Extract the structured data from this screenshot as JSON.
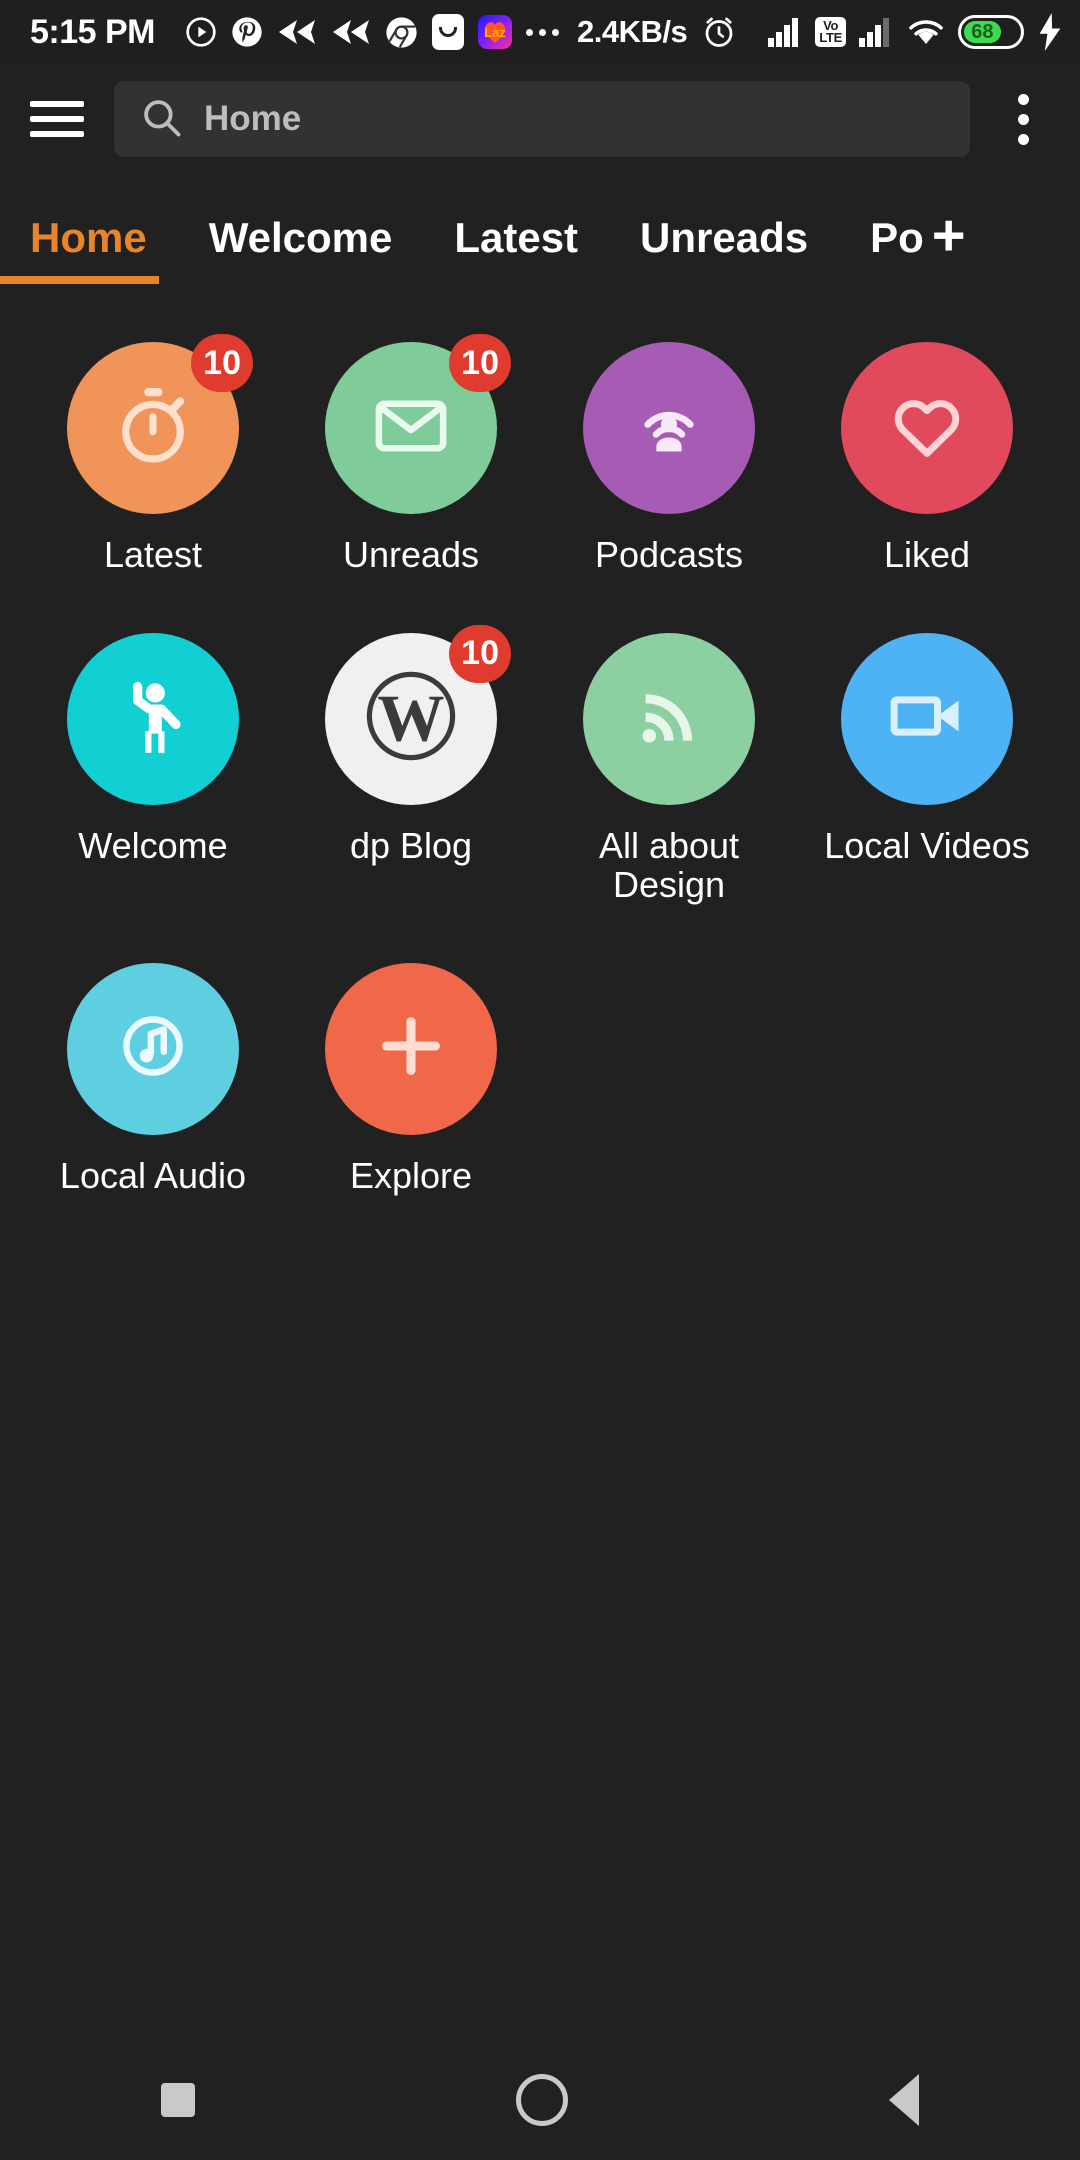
{
  "statusbar": {
    "time": "5:15 PM",
    "network_speed": "2.4KB/s",
    "battery_percent": "68",
    "volte_top": "Vo",
    "volte_bottom": "LTE",
    "laz_label": "Laz",
    "icons": [
      "play-circle-icon",
      "pinterest-icon",
      "arrow-left-double-icon",
      "arrow-left-double-icon",
      "chrome-icon",
      "smile-app-icon",
      "lazada-icon",
      "more-dots-icon",
      "alarm-clock-icon",
      "signal-bars-icon",
      "volte-icon",
      "signal-bars-icon",
      "wifi-icon",
      "battery-icon",
      "charging-bolt-icon"
    ]
  },
  "toolbar": {
    "menu_icon": "hamburger-menu-icon",
    "search_icon": "search-icon",
    "search_value": "Home",
    "search_placeholder": "Home",
    "overflow_icon": "overflow-menu-icon"
  },
  "tabs": {
    "items": [
      {
        "label": "Home",
        "active": true
      },
      {
        "label": "Welcome",
        "active": false
      },
      {
        "label": "Latest",
        "active": false
      },
      {
        "label": "Unreads",
        "active": false
      },
      {
        "label": "Po",
        "active": false
      }
    ],
    "add_label": "+",
    "accent_color": "#e8852a"
  },
  "grid": {
    "items": [
      {
        "label": "Latest",
        "icon": "stopwatch-icon",
        "color": "#f0945a",
        "badge": "10"
      },
      {
        "label": "Unreads",
        "icon": "envelope-icon",
        "color": "#7fcc9a",
        "badge": "10"
      },
      {
        "label": "Podcasts",
        "icon": "podcast-icon",
        "color": "#a65cb5",
        "badge": ""
      },
      {
        "label": "Liked",
        "icon": "heart-icon",
        "color": "#e04a5c",
        "badge": ""
      },
      {
        "label": "Welcome",
        "icon": "waving-person-icon",
        "color": "#12cfd4",
        "badge": ""
      },
      {
        "label": "dp Blog",
        "icon": "wordpress-icon",
        "color": "#f0f0f0",
        "badge": "10"
      },
      {
        "label": "All about Design",
        "icon": "rss-feed-icon",
        "color": "#8ccfa0",
        "badge": ""
      },
      {
        "label": "Local Videos",
        "icon": "video-camera-icon",
        "color": "#4eb3f5",
        "badge": ""
      },
      {
        "label": "Local Audio",
        "icon": "music-note-icon",
        "color": "#5ecfe0",
        "badge": ""
      },
      {
        "label": "Explore",
        "icon": "plus-icon",
        "color": "#f06749",
        "badge": ""
      }
    ]
  },
  "navbar": {
    "recents_icon": "square-recents-icon",
    "home_icon": "circle-home-icon",
    "back_icon": "triangle-back-icon"
  }
}
